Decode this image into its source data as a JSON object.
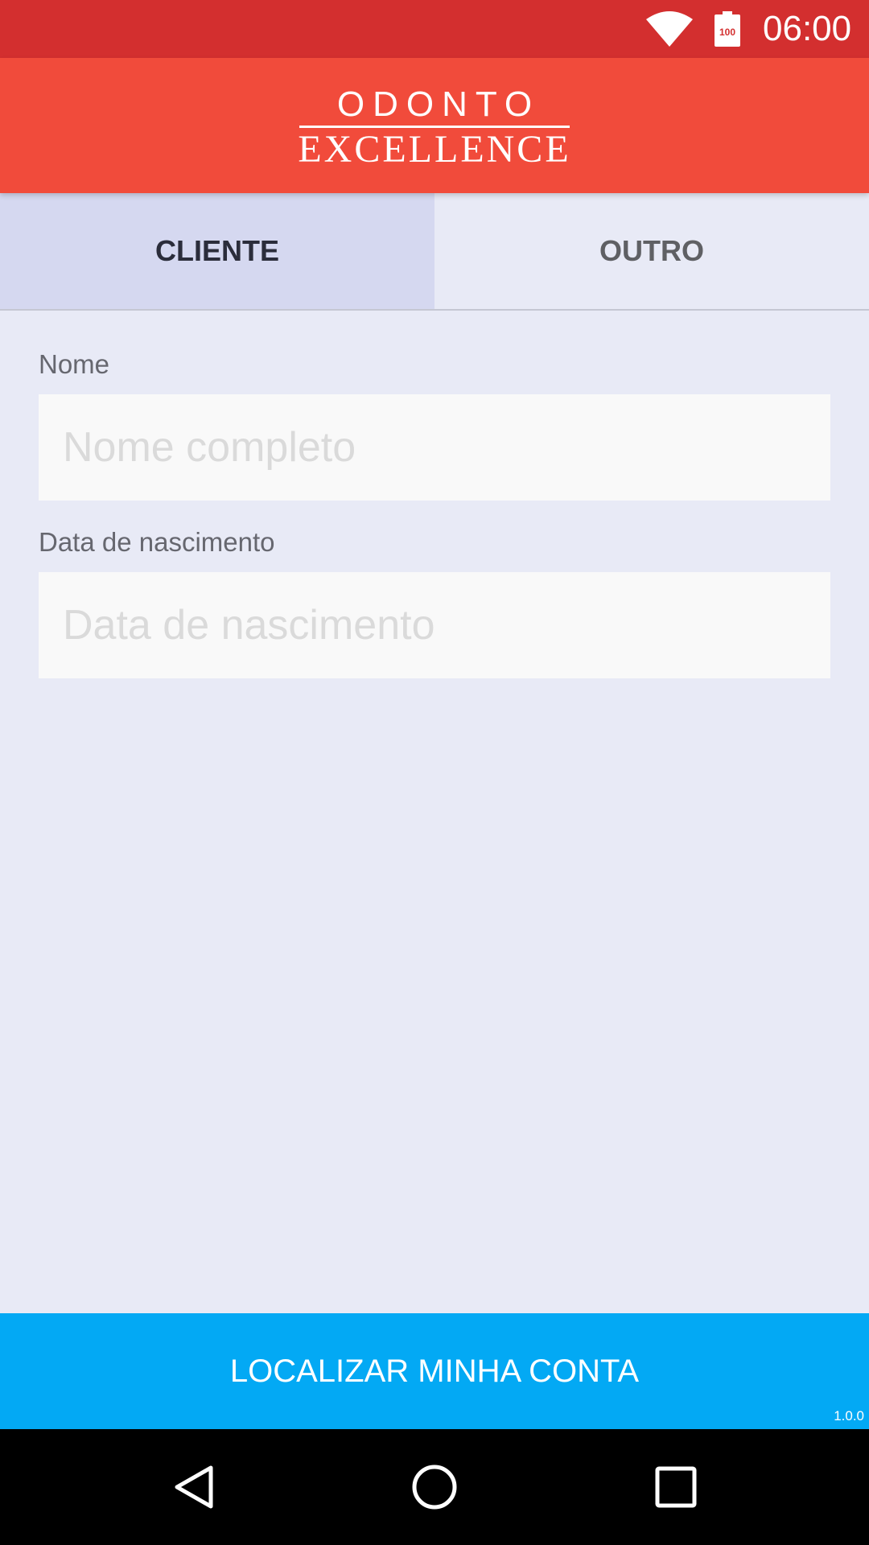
{
  "status_bar": {
    "time": "06:00",
    "battery_level": "100",
    "wifi_icon": "wifi-icon",
    "battery_icon": "battery-icon"
  },
  "app_bar": {
    "logo_line1": "ODONTO",
    "logo_line2": "EXCELLENCE"
  },
  "tabs": [
    {
      "label": "CLIENTE",
      "active": true
    },
    {
      "label": "OUTRO",
      "active": false
    }
  ],
  "form": {
    "name": {
      "label": "Nome",
      "placeholder": "Nome completo",
      "value": ""
    },
    "birthdate": {
      "label": "Data de nascimento",
      "placeholder": "Data de nascimento",
      "value": ""
    }
  },
  "cta": {
    "label": "LOCALIZAR MINHA CONTA"
  },
  "version": "1.0.0",
  "nav_bar": {
    "back_icon": "back-triangle-icon",
    "home_icon": "home-circle-icon",
    "recents_icon": "recents-square-icon"
  },
  "colors": {
    "status_bar": "#d32f2f",
    "app_bar": "#f14b3b",
    "background": "#e8eaf6",
    "active_tab": "#d5d8f0",
    "cta": "#03a9f4",
    "nav_bar": "#000000"
  }
}
